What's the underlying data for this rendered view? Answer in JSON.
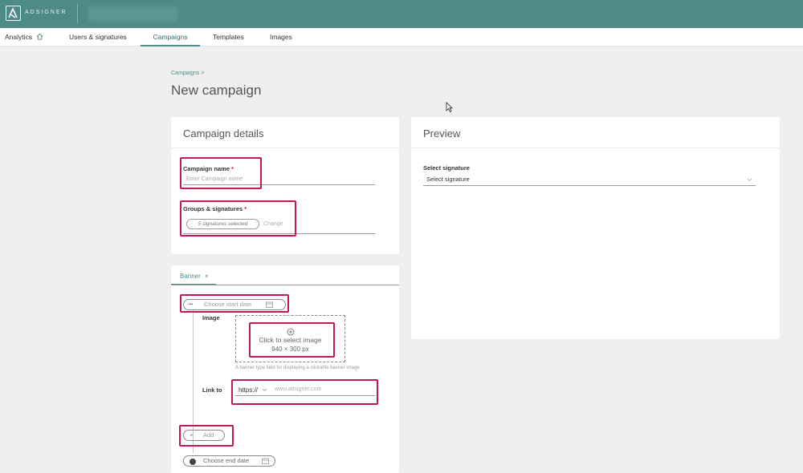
{
  "app": {
    "logo_text": "ADSIGNER"
  },
  "nav": {
    "items": [
      {
        "label": "Analytics"
      },
      {
        "label": "Users & signatures"
      },
      {
        "label": "Campaigns"
      },
      {
        "label": "Templates"
      },
      {
        "label": "Images"
      }
    ],
    "active": "Campaigns"
  },
  "breadcrumb": "Campaigns >",
  "page_title": "New campaign",
  "details": {
    "title": "Campaign details",
    "name_label": "Campaign name",
    "required_mark": "*",
    "name_placeholder": "Enter Campaign name",
    "groups_label": "Groups & signatures",
    "signatures_chip": "5 signatures selected",
    "change_link": "Change"
  },
  "banner": {
    "tab_label": "Banner",
    "tab_close": "×",
    "start_dots": "•••",
    "start_date_placeholder": "Choose start date",
    "image_label": "Image",
    "image_cta": "Click to select image",
    "image_size": "940 × 300 px",
    "image_help": "A banner type field for displaying a clickable banner image",
    "link_label": "Link to",
    "protocol": "https://",
    "url_placeholder": "www.adsigner.com",
    "add_label": "Add",
    "end_date_placeholder": "Choose end date"
  },
  "preview": {
    "title": "Preview",
    "select_label": "Select signature",
    "select_value": "Select signature"
  },
  "colors": {
    "topbar": "#4e8a87",
    "accent": "#4e8a87",
    "highlight": "#c2185b"
  }
}
